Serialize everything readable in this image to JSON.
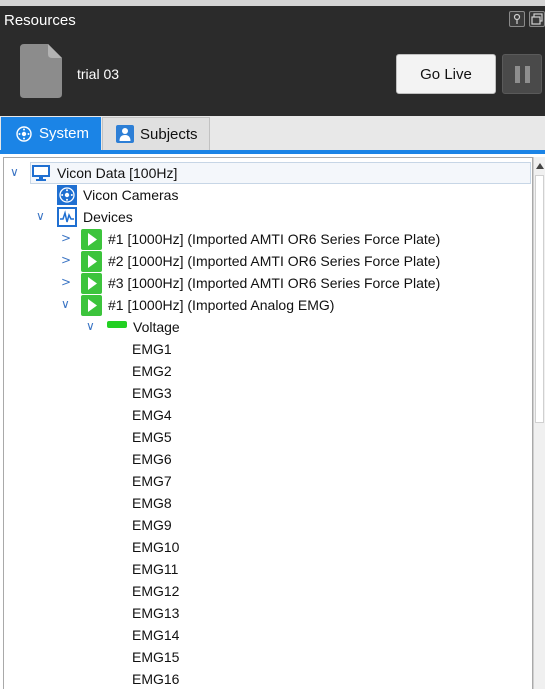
{
  "panel": {
    "title": "Resources"
  },
  "header": {
    "trial_name": "trial 03",
    "go_live_label": "Go Live"
  },
  "tabs": [
    {
      "label": "System",
      "active": true
    },
    {
      "label": "Subjects",
      "active": false
    }
  ],
  "tree": {
    "root": {
      "label": "Vicon Data [100Hz]"
    },
    "cameras": {
      "label": "Vicon Cameras"
    },
    "devices": {
      "label": "Devices"
    },
    "device_items": [
      {
        "label": "#1 [1000Hz] (Imported AMTI OR6 Series Force Plate)"
      },
      {
        "label": "#2 [1000Hz] (Imported AMTI OR6 Series Force Plate)"
      },
      {
        "label": "#3 [1000Hz] (Imported AMTI OR6 Series Force Plate)"
      },
      {
        "label": "#1 [1000Hz] (Imported Analog EMG)"
      }
    ],
    "voltage": {
      "label": "Voltage"
    },
    "channels": [
      "EMG1",
      "EMG2",
      "EMG3",
      "EMG4",
      "EMG5",
      "EMG6",
      "EMG7",
      "EMG8",
      "EMG9",
      "EMG10",
      "EMG11",
      "EMG12",
      "EMG13",
      "EMG14",
      "EMG15",
      "EMG16"
    ]
  },
  "colors": {
    "accent": "#1b84e6",
    "device_green": "#3cc43c",
    "voltage_green": "#22d022",
    "chrome_dark": "#2b2b2b"
  },
  "icons": {
    "file": "file-icon",
    "root": "monitor-icon",
    "cameras": "camera-grid-icon",
    "devices": "waveform-icon",
    "device": "play-icon",
    "voltage": "voltage-bar-icon"
  }
}
